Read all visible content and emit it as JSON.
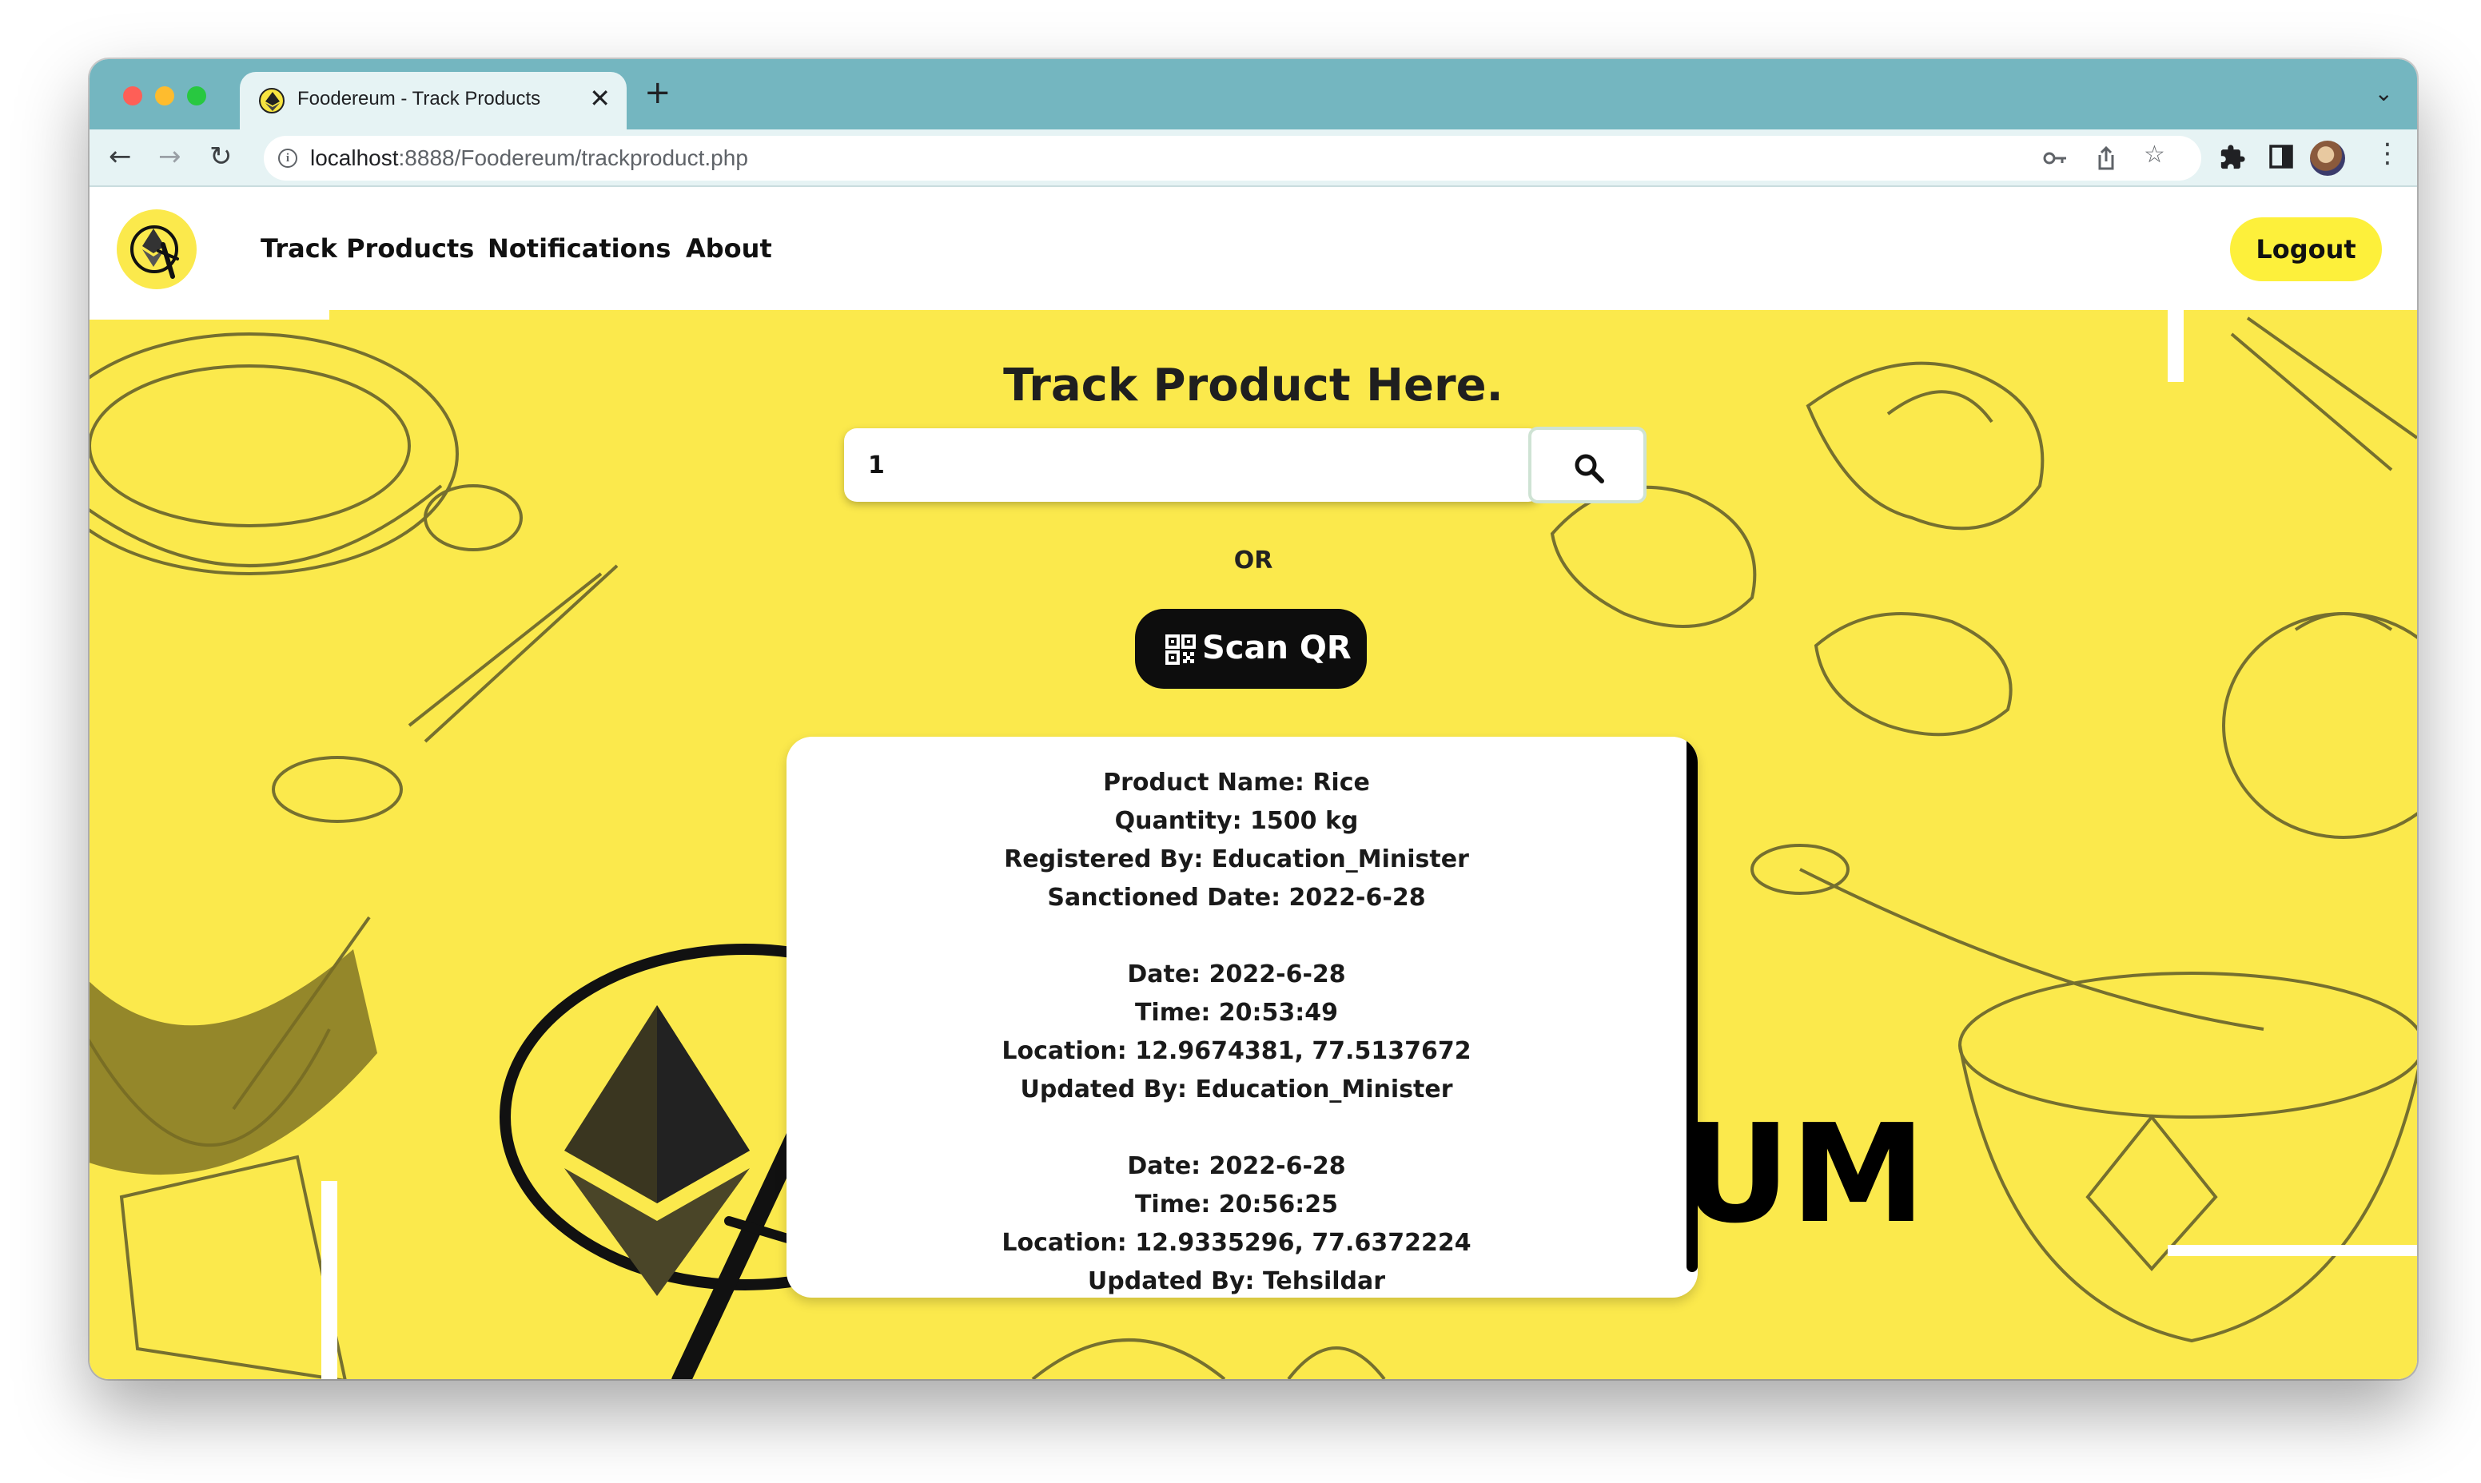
{
  "browser": {
    "tab_title": "Foodereum - Track Products",
    "url_host": "localhost",
    "url_rest": ":8888/Foodereum/trackproduct.php"
  },
  "navbar": {
    "links": [
      "Track Products",
      "Notifications",
      "About"
    ],
    "logout_label": "Logout"
  },
  "hero": {
    "title": "Track Product Here.",
    "search_value": "1",
    "or_text": "OR",
    "scan_label": "Scan QR",
    "background_word": "UM"
  },
  "result": {
    "product": {
      "name_line": "Product Name: Rice",
      "quantity_line": "Quantity: 1500 kg",
      "registered_line": "Registered By: Education_Minister",
      "sanctioned_line": "Sanctioned Date: 2022-6-28"
    },
    "updates": [
      {
        "date_line": "Date: 2022-6-28",
        "time_line": "Time: 20:53:49",
        "location_line": "Location: 12.9674381, 77.5137672",
        "updated_line": "Updated By: Education_Minister"
      },
      {
        "date_line": "Date: 2022-6-28",
        "time_line": "Time: 20:56:25",
        "location_line": "Location: 12.9335296, 77.6372224",
        "updated_line": "Updated By: Tehsildar"
      }
    ]
  },
  "colors": {
    "hero_bg": "#fbe94c",
    "logout_bg": "#fdf03b",
    "scan_bg": "#0d0d0d",
    "tabstrip": "#74b6c0"
  },
  "icons": [
    "search-icon",
    "qr-code-icon",
    "key-icon",
    "share-icon",
    "star-icon",
    "extensions-icon",
    "side-panel-icon",
    "more-icon"
  ]
}
